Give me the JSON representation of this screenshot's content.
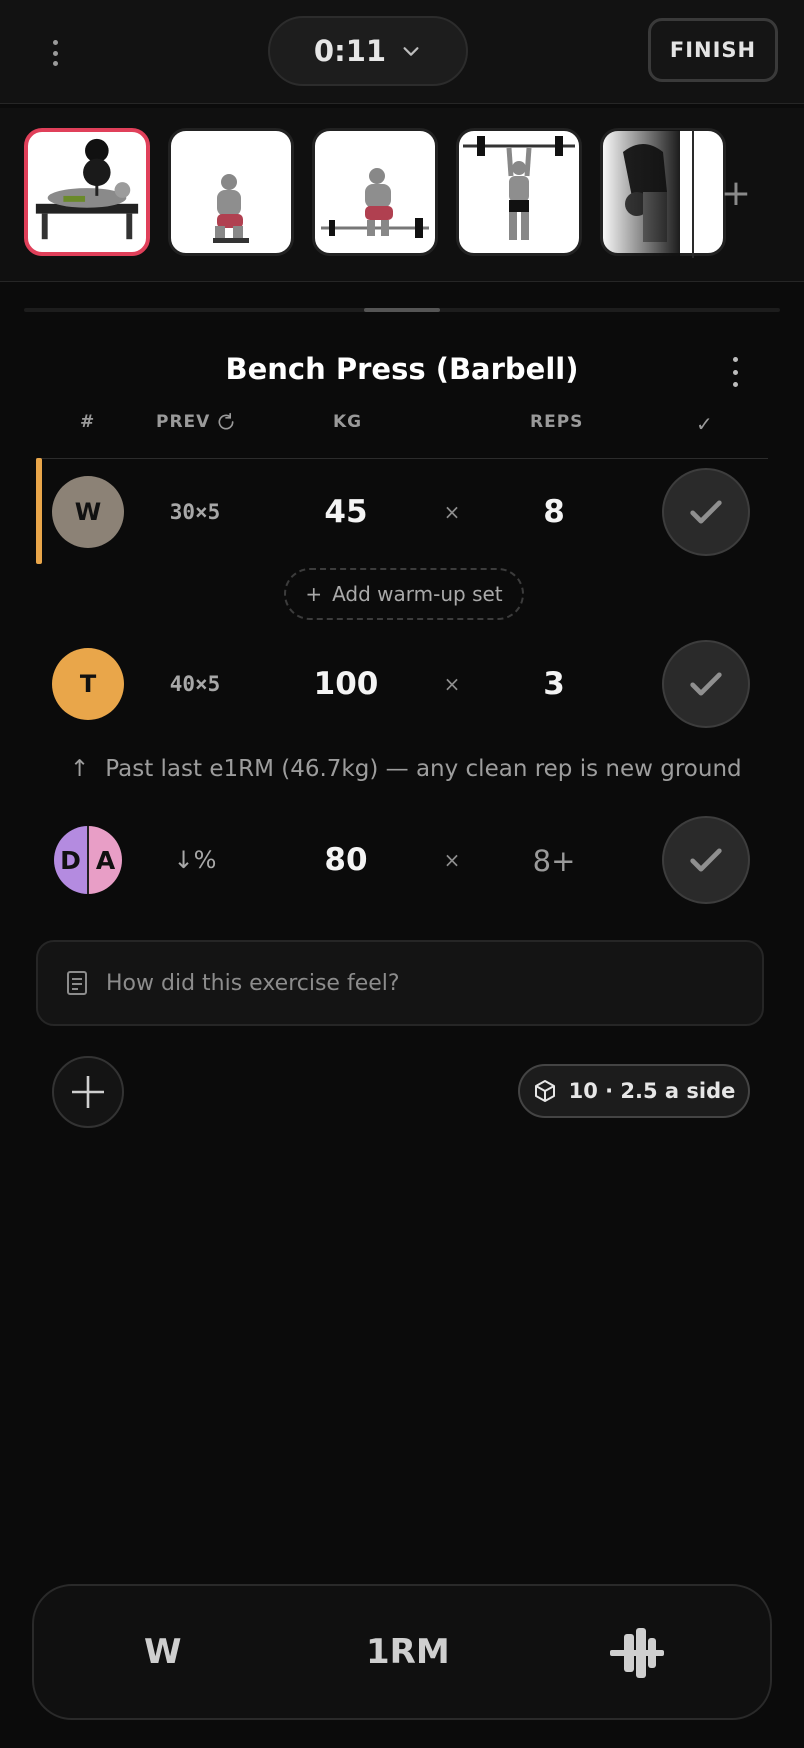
{
  "topbar": {
    "timer": "0:11",
    "finish_label": "FINISH"
  },
  "exercise_strip": {
    "thumbnails": [
      "bench-press",
      "squat",
      "deadlift",
      "overhead-press",
      "row"
    ],
    "active_index": 0,
    "accent_color": "#e0405a"
  },
  "exercise": {
    "title": "Bench Press (Barbell)",
    "headers": {
      "num": "#",
      "prev": "PREV",
      "kg": "KG",
      "reps": "REPS",
      "check": "✓"
    },
    "sets": [
      {
        "badge": "W",
        "badge_color": "#8c8276",
        "prev": "30×5",
        "kg": "45",
        "times": "×",
        "reps": "8"
      },
      {
        "badge": "T",
        "badge_color": "#e9a64a",
        "prev": "40×5",
        "kg": "100",
        "times": "×",
        "reps": "3"
      },
      {
        "badge_left": "D",
        "badge_right": "A",
        "prev": "↓%",
        "kg": "80",
        "times": "×",
        "reps": "8+"
      }
    ],
    "add_warmup_label": "Add warm-up set",
    "hint_arrow": "↑",
    "hint_text": "Past last e1RM (46.7kg) — any clean rep is new ground",
    "note_placeholder": "How did this exercise feel?",
    "plate_text": "10 · 2.5 a side"
  },
  "bottom_bar": {
    "left_label": "W",
    "mid_label": "1RM",
    "right_icon": "barbell-plates-icon"
  }
}
